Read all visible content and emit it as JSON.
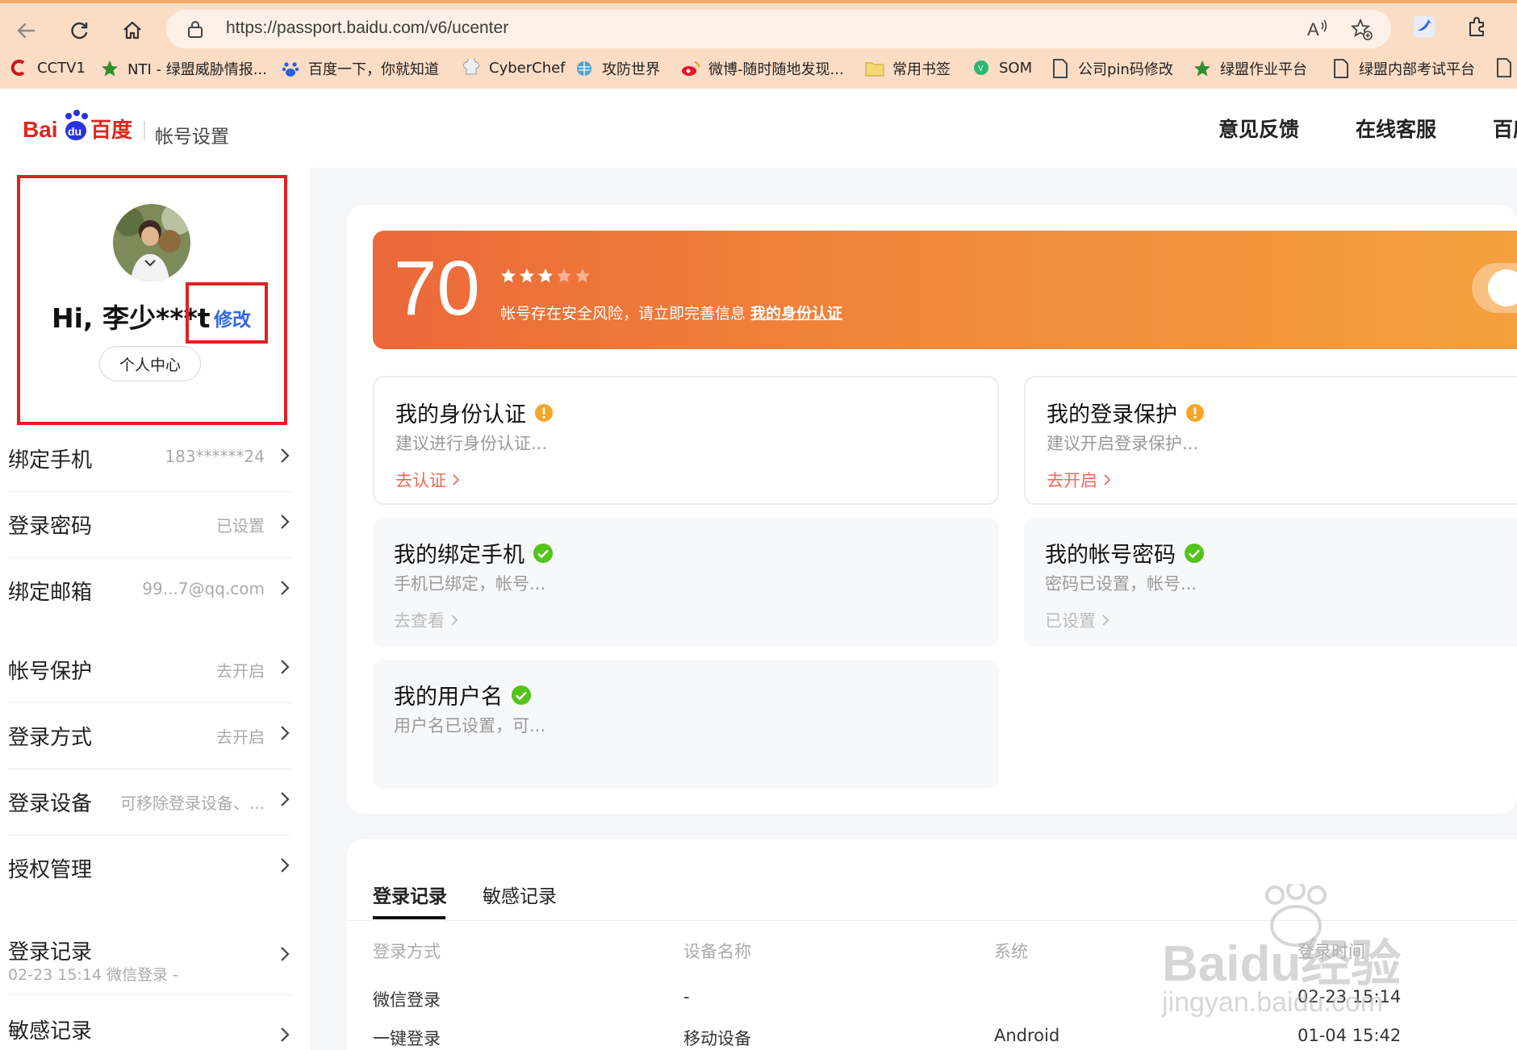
{
  "browser": {
    "url": "https://passport.baidu.com/v6/ucenter",
    "bookmarks": [
      {
        "label": "CCTV1",
        "icon": "cctv-icon"
      },
      {
        "label": "NTI - 绿盟威胁情报...",
        "icon": "star-icon"
      },
      {
        "label": "百度一下，你就知道",
        "icon": "baidu-paw-icon"
      },
      {
        "label": "CyberChef",
        "icon": "chef-icon"
      },
      {
        "label": "攻防世界",
        "icon": "globe-icon"
      },
      {
        "label": "微博-随时随地发现...",
        "icon": "weibo-icon"
      },
      {
        "label": "常用书签",
        "icon": "folder-icon"
      },
      {
        "label": "SOM",
        "icon": "som-icon"
      },
      {
        "label": "公司pin码修改",
        "icon": "page-icon"
      },
      {
        "label": "绿盟作业平台",
        "icon": "star-icon"
      },
      {
        "label": "绿盟内部考试平台",
        "icon": "page-icon"
      }
    ]
  },
  "header": {
    "account_title": "帐号设置",
    "links": [
      "意见反馈",
      "在线客服",
      "百度"
    ]
  },
  "profile": {
    "greeting": "Hi, 李少***t",
    "edit_label": "修改",
    "center_button": "个人中心"
  },
  "sidebar": {
    "items": [
      {
        "label": "绑定手机",
        "value": "183******24"
      },
      {
        "label": "登录密码",
        "value": "已设置"
      },
      {
        "label": "绑定邮箱",
        "value": "99...7@qq.com"
      },
      {
        "label": "帐号保护",
        "value": "去开启"
      },
      {
        "label": "登录方式",
        "value": "去开启"
      },
      {
        "label": "登录设备",
        "value": "可移除登录设备、..."
      },
      {
        "label": "授权管理",
        "value": ""
      },
      {
        "label": "登录记录",
        "value": "",
        "sub": "02-23 15:14 微信登录 -"
      },
      {
        "label": "敏感记录",
        "value": ""
      }
    ]
  },
  "banner": {
    "score": "70",
    "stars_filled": 3,
    "stars_total": 5,
    "message": "帐号存在安全风险，请立即完善信息",
    "link": "我的身份认证"
  },
  "security_cards": [
    {
      "title": "我的身份认证",
      "status": "warning",
      "desc": "建议进行身份认证...",
      "action": "去认证"
    },
    {
      "title": "我的登录保护",
      "status": "warning",
      "desc": "建议开启登录保护...",
      "action": "去开启"
    },
    {
      "title": "我的绑定手机",
      "status": "ok",
      "desc": "手机已绑定，帐号...",
      "action": "去查看"
    },
    {
      "title": "我的帐号密码",
      "status": "ok",
      "desc": "密码已设置，帐号...",
      "action": "已设置"
    },
    {
      "title": "我的用户名",
      "status": "ok",
      "desc": "用户名已设置，可...",
      "action": ""
    }
  ],
  "records": {
    "tabs": [
      "登录记录",
      "敏感记录"
    ],
    "columns": [
      "登录方式",
      "设备名称",
      "系统",
      "登录时间"
    ],
    "rows": [
      [
        "微信登录",
        "-",
        "",
        "02-23 15:14"
      ],
      [
        "一键登录",
        "移动设备",
        "Android",
        "01-04 15:42"
      ]
    ]
  },
  "watermark": {
    "brand": "Baidu经验",
    "domain": "jingyan.baidu.com"
  },
  "colors": {
    "accent_red": "#e02020",
    "link_blue": "#3066e8",
    "banner_start": "#ec683a",
    "banner_end": "#f4a03e",
    "warning": "#f5a623",
    "ok": "#52c41a"
  }
}
